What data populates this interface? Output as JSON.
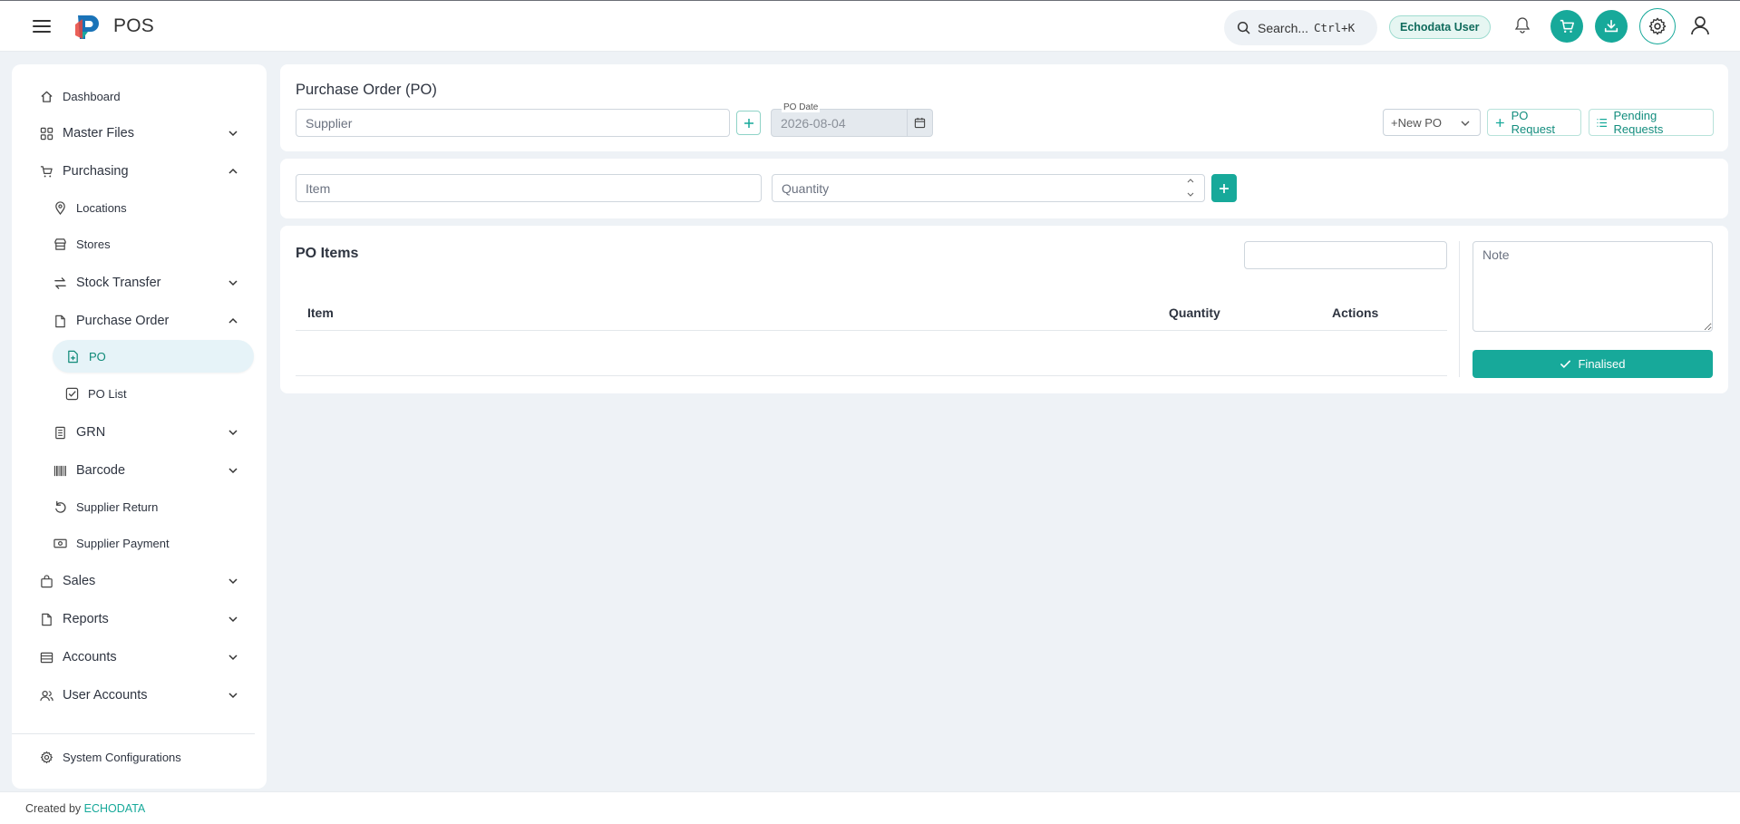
{
  "app": {
    "brand": "POS"
  },
  "header": {
    "search_label": "Search...",
    "search_shortcut": "Ctrl+K",
    "user_badge": "Echodata User"
  },
  "sidebar": {
    "items": [
      {
        "label": "Dashboard",
        "icon": "home-icon"
      },
      {
        "label": "Master Files",
        "icon": "grid-icon",
        "expanded": false
      },
      {
        "label": "Purchasing",
        "icon": "cart-icon",
        "expanded": true
      },
      {
        "label": "Locations",
        "icon": "map-pin-icon"
      },
      {
        "label": "Stores",
        "icon": "store-icon"
      },
      {
        "label": "Stock Transfer",
        "icon": "transfer-icon",
        "expanded": false
      },
      {
        "label": "Purchase Order",
        "icon": "file-icon",
        "expanded": true
      },
      {
        "label": "PO",
        "icon": "file-plus-icon",
        "active": true
      },
      {
        "label": "PO List",
        "icon": "checkbox-icon"
      },
      {
        "label": "GRN",
        "icon": "receipt-icon",
        "expanded": false
      },
      {
        "label": "Barcode",
        "icon": "barcode-icon",
        "expanded": false
      },
      {
        "label": "Supplier Return",
        "icon": "undo-icon"
      },
      {
        "label": "Supplier Payment",
        "icon": "cash-icon"
      },
      {
        "label": "Sales",
        "icon": "bag-icon",
        "expanded": false
      },
      {
        "label": "Reports",
        "icon": "document-icon",
        "expanded": false
      },
      {
        "label": "Accounts",
        "icon": "ledger-icon",
        "expanded": false
      },
      {
        "label": "User Accounts",
        "icon": "users-icon",
        "expanded": false
      }
    ],
    "system_config": "System Configurations"
  },
  "po_form": {
    "title": "Purchase Order (PO)",
    "supplier_placeholder": "Supplier",
    "po_date_label": "PO Date",
    "po_date_value": "2026-08-04",
    "new_po_label": "+New PO",
    "po_request_label": "PO Request",
    "pending_requests_label": "Pending Requests"
  },
  "item_entry": {
    "item_placeholder": "Item",
    "quantity_placeholder": "Quantity"
  },
  "po_items": {
    "title": "PO Items",
    "search_value": "",
    "columns": [
      "Item",
      "Quantity",
      "Actions"
    ],
    "rows": [],
    "note_placeholder": "Note",
    "finalise_label": "Finalised"
  },
  "footer": {
    "created_by": "Created by",
    "company": "ECHODATA"
  },
  "colors": {
    "accent": "#17a99a",
    "background": "#eef2f6",
    "active_pill": "#e6f3f8"
  }
}
